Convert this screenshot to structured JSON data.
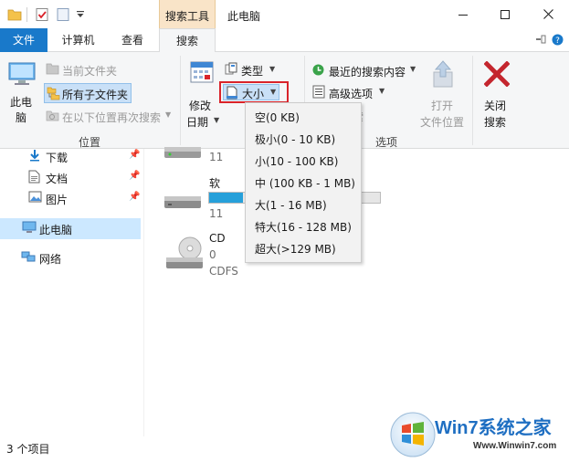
{
  "window": {
    "title": "此电脑",
    "context_tab_group": "搜索工具",
    "controls": [
      "minimize",
      "maximize",
      "close"
    ]
  },
  "quick_access": {
    "icons": [
      "folder-icon",
      "properties-checkmark-icon",
      "new-folder-icon",
      "customize-dropdown-icon"
    ]
  },
  "tabs": {
    "file": "文件",
    "computer": "计算机",
    "view": "查看",
    "search": "搜索"
  },
  "ribbon": {
    "location_group": {
      "label": "位置",
      "this_pc_line1": "此电",
      "this_pc_line2": "脑",
      "current_folder": "当前文件夹",
      "all_subfolders": "所有子文件夹",
      "search_again": "在以下位置再次搜索"
    },
    "refine_group": {
      "date_modified_line1": "修改",
      "date_modified_line2": "日期",
      "kind": "类型",
      "size": "大小",
      "label_partial": "索"
    },
    "options_group": {
      "label": "选项",
      "recent_searches": "最近的搜索内容",
      "advanced_options": "高级选项",
      "open_file_location_line1": "打开",
      "open_file_location_line2": "文件位置"
    },
    "close_group": {
      "close_search_line1": "关闭",
      "close_search_line2": "搜索"
    }
  },
  "size_menu": {
    "items": [
      "空(0 KB)",
      "极小(0 - 10 KB)",
      "小(10 - 100 KB)",
      "中 (100 KB - 1 MB)",
      "大(1 - 16 MB)",
      "特大(16 - 128 MB)",
      "超大(>129 MB)"
    ]
  },
  "nav": {
    "downloads": "下载",
    "documents": "文档",
    "pictures": "图片",
    "this_pc": "此电脑",
    "network": "网络"
  },
  "content": {
    "drive1": {
      "meta_partial": "11"
    },
    "drive2": {
      "name_partial": "软",
      "meta_partial": "11",
      "usage_fraction": 0.2
    },
    "drive3": {
      "name_partial": "CD",
      "meta_partial": "0 ",
      "filesystem": "CDFS"
    }
  },
  "status": {
    "item_count": "3 个项目"
  },
  "watermark": {
    "brand": "Win7系统之家",
    "url": "Www.Winwin7.com"
  },
  "colors": {
    "accent": "#1979ca",
    "context_tab": "#f9e4c8",
    "selection": "#cce8ff",
    "highlight_box": "#d9232a",
    "close_red": "#c4262e",
    "usage_fill": "#26a0da"
  }
}
